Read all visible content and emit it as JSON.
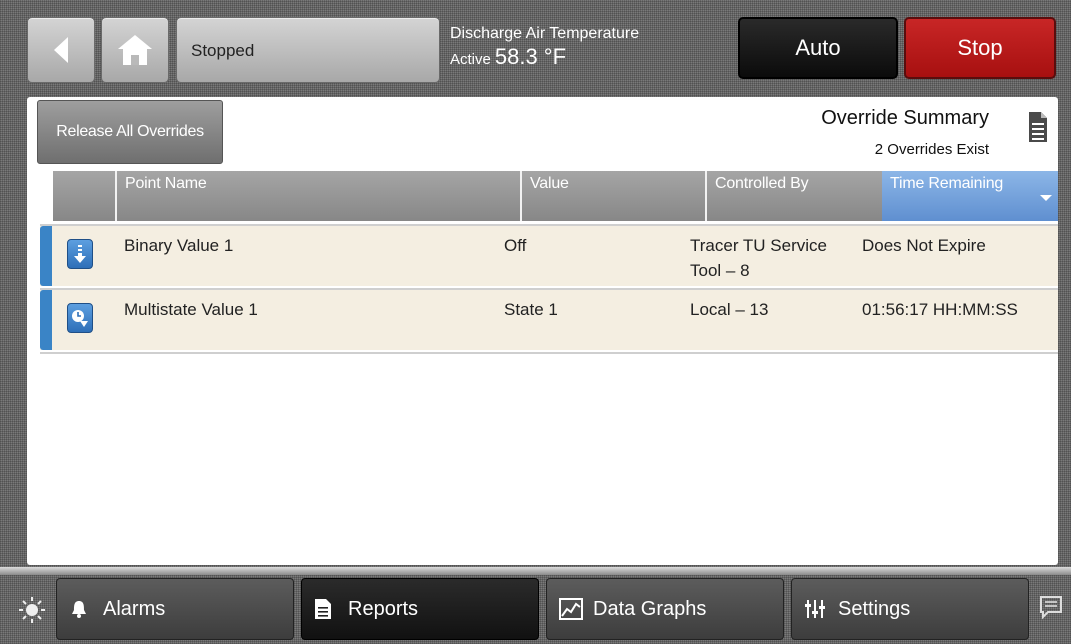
{
  "header": {
    "status_text": "Stopped",
    "discharge_title": "Discharge Air Temperature",
    "discharge_active_label": "Active",
    "discharge_value": "58.3 °F",
    "auto_label": "Auto",
    "stop_label": "Stop",
    "stop_color": "#b81b1b"
  },
  "summary": {
    "release_label": "Release All Overrides",
    "title": "Override Summary",
    "count_text": "2 Overrides Exist"
  },
  "table": {
    "columns": [
      "Point Name",
      "Value",
      "Controlled By",
      "Time Remaining"
    ],
    "sorted_column": "Time Remaining",
    "rows": [
      {
        "icon": "override-down-icon",
        "point_name": "Binary Value 1",
        "value": "Off",
        "controlled_by_line1": "Tracer TU Service",
        "controlled_by_line2": "Tool – 8",
        "time_remaining": "Does Not Expire"
      },
      {
        "icon": "timed-override-icon",
        "point_name": "Multistate Value 1",
        "value": "State 1",
        "controlled_by_line1": "Local – 13",
        "controlled_by_line2": "",
        "time_remaining": "01:56:17 HH:MM:SS"
      }
    ]
  },
  "nav": {
    "items": [
      {
        "label": "Alarms",
        "icon": "bell-icon"
      },
      {
        "label": "Reports",
        "icon": "document-icon",
        "active": true
      },
      {
        "label": "Data Graphs",
        "icon": "graph-icon"
      },
      {
        "label": "Settings",
        "icon": "sliders-icon"
      }
    ]
  },
  "colors": {
    "accent_blue": "#3a84c6",
    "row_bg": "#f4eee1",
    "sorted_header": "#6f9fdc"
  }
}
